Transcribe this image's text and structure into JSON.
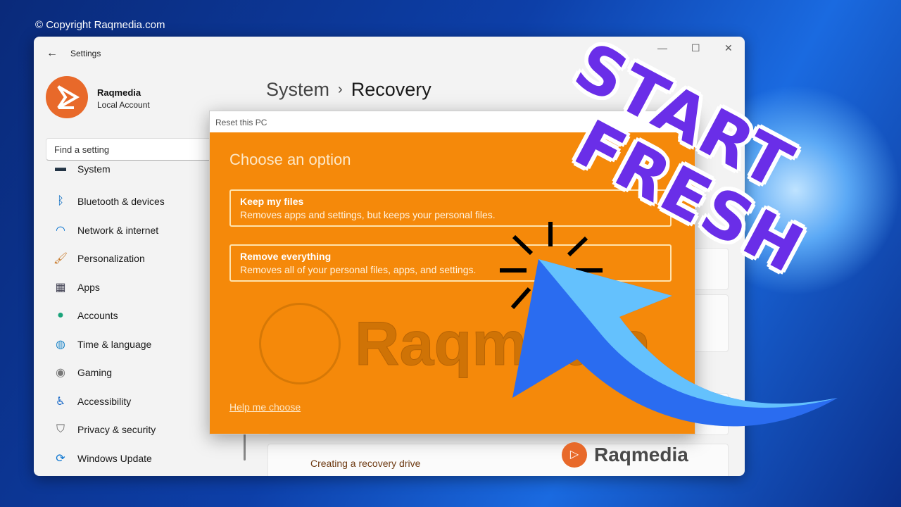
{
  "copyright": "© Copyright Raqmedia.com",
  "window": {
    "title": "Settings",
    "controls": {
      "minimize": "—",
      "maximize": "☐",
      "close": "✕"
    }
  },
  "account": {
    "name": "Raqmedia",
    "type": "Local Account"
  },
  "search": {
    "placeholder": "Find a setting"
  },
  "sidebar": {
    "items": [
      {
        "label": "System",
        "icon": "system-icon"
      },
      {
        "label": "Bluetooth & devices",
        "icon": "bluetooth-icon",
        "glyph": "ᛒ",
        "color": "#0067c0"
      },
      {
        "label": "Network & internet",
        "icon": "wifi-icon",
        "glyph": "◠",
        "color": "#0a74d0"
      },
      {
        "label": "Personalization",
        "icon": "brush-icon",
        "glyph": "🖌",
        "color": "#c87a2a"
      },
      {
        "label": "Apps",
        "icon": "apps-icon",
        "glyph": "▦",
        "color": "#445"
      },
      {
        "label": "Accounts",
        "icon": "accounts-icon",
        "glyph": "●",
        "color": "#1aa37a"
      },
      {
        "label": "Time & language",
        "icon": "globe-clock-icon",
        "glyph": "◍",
        "color": "#1f86c8"
      },
      {
        "label": "Gaming",
        "icon": "gamepad-icon",
        "glyph": "◉",
        "color": "#777"
      },
      {
        "label": "Accessibility",
        "icon": "accessibility-icon",
        "glyph": "♿",
        "color": "#1a6ac8"
      },
      {
        "label": "Privacy & security",
        "icon": "shield-icon",
        "glyph": "⛉",
        "color": "#666"
      },
      {
        "label": "Windows Update",
        "icon": "update-icon",
        "glyph": "⟳",
        "color": "#0a74d0"
      }
    ]
  },
  "breadcrumb": {
    "parent": "System",
    "separator": "›",
    "current": "Recovery"
  },
  "content": {
    "recovery_drive_link": "Creating a recovery drive"
  },
  "dialog": {
    "title": "Reset this PC",
    "heading": "Choose an option",
    "options": [
      {
        "title": "Keep my files",
        "description": "Removes apps and settings, but keeps your personal files."
      },
      {
        "title": "Remove everything",
        "description": "Removes all of your personal files, apps, and settings."
      }
    ],
    "help_link": "Help me choose",
    "watermark": "Raqmedia",
    "color": "#f5890a"
  },
  "overlay": {
    "line1": "START",
    "line2": "FRESH",
    "color": "#6a2ee8",
    "arrow_color": "#2a6cf0"
  },
  "brand_logo": {
    "text": "Raqmedia",
    "color": "#e8692a"
  }
}
